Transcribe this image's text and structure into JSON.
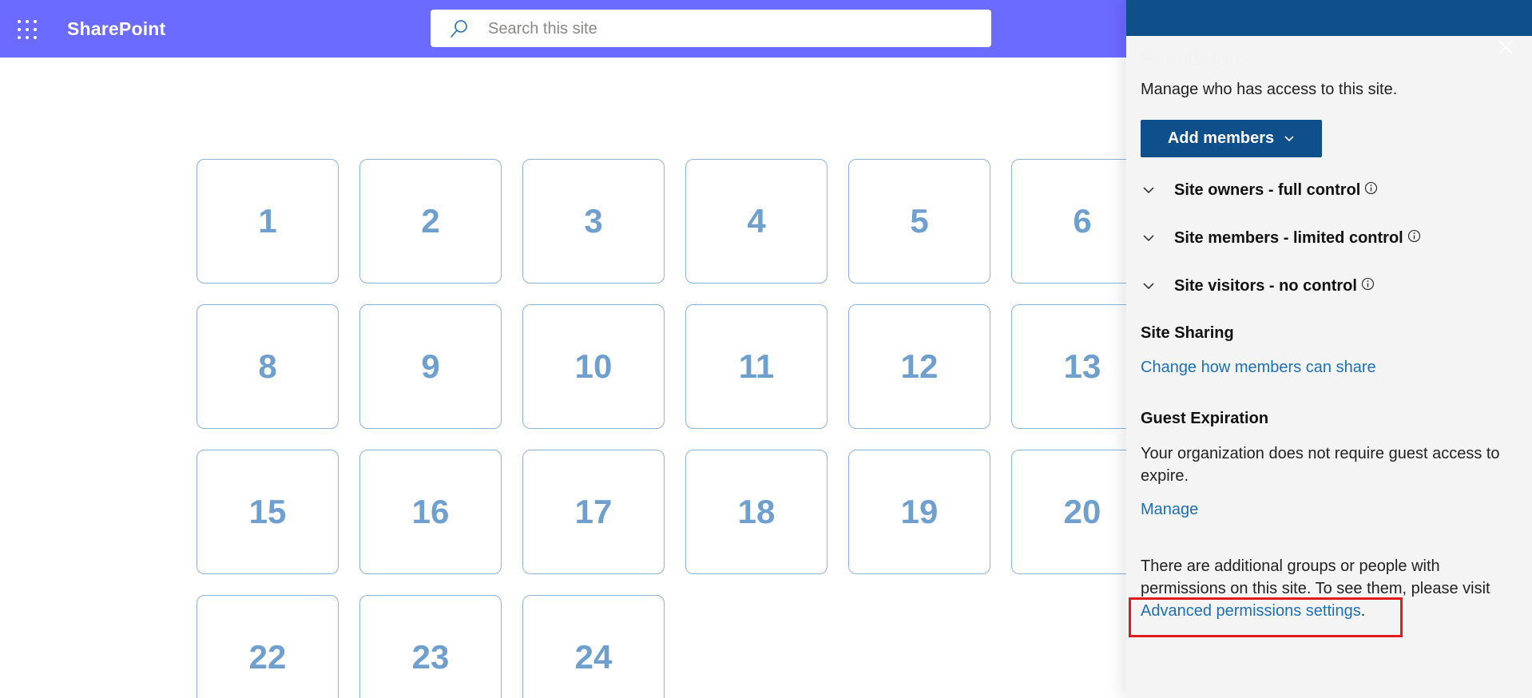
{
  "header": {
    "app_name": "SharePoint",
    "search_placeholder": "Search this site"
  },
  "tiles": [
    "1",
    "2",
    "3",
    "4",
    "5",
    "6",
    "8",
    "9",
    "10",
    "11",
    "12",
    "13",
    "15",
    "16",
    "17",
    "18",
    "19",
    "20",
    "22",
    "23",
    "24"
  ],
  "panel": {
    "title": "Permissions",
    "description": "Manage who has access to this site.",
    "add_members_label": "Add members",
    "groups": [
      {
        "label": "Site owners - full control"
      },
      {
        "label": "Site members - limited control"
      },
      {
        "label": "Site visitors - no control"
      }
    ],
    "site_sharing": {
      "heading": "Site Sharing",
      "link": "Change how members can share"
    },
    "guest_expiration": {
      "heading": "Guest Expiration",
      "text": "Your organization does not require guest access to expire.",
      "link": "Manage"
    },
    "additional": {
      "text": "There are additional groups or people with permissions on this site. To see them, please visit ",
      "link": "Advanced permissions settings",
      "suffix": "."
    }
  },
  "colors": {
    "topbar": "#6b6bff",
    "panel_strip": "#0f4f8c",
    "tile_text": "#6e9fcf",
    "link": "#1f6fb4",
    "highlight": "#e01b1b"
  }
}
